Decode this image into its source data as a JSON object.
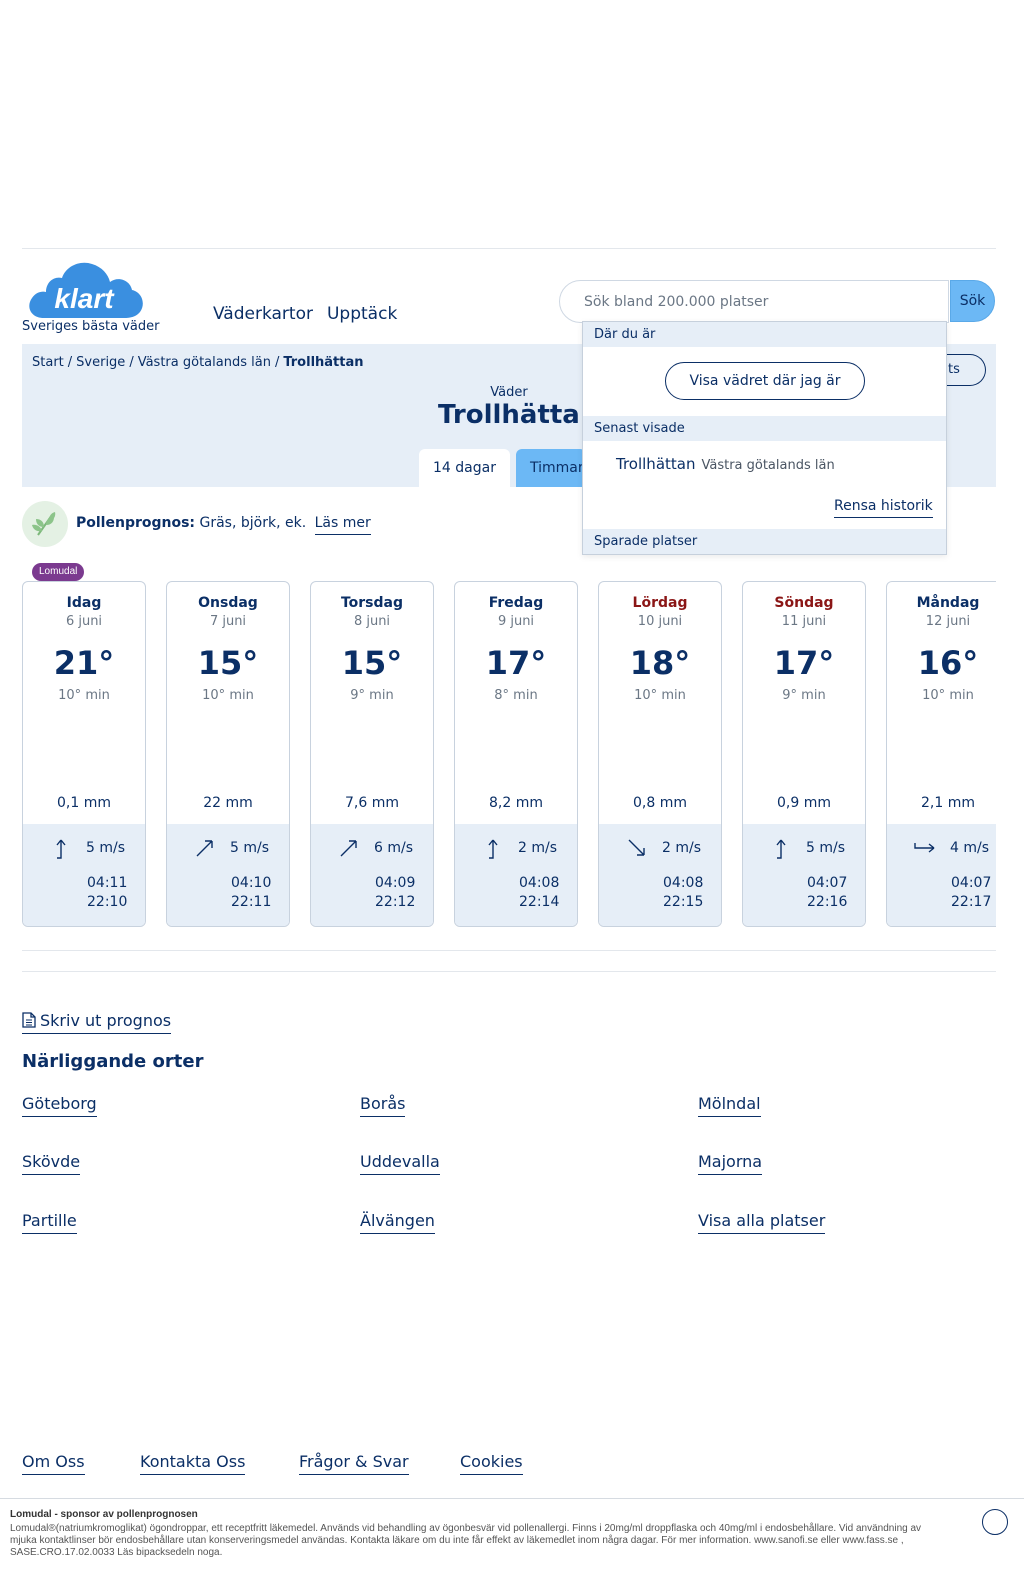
{
  "header": {
    "logo_text": "klart",
    "tagline": "Sveriges bästa väder",
    "nav": [
      "Väderkartor",
      "Upptäck"
    ],
    "search_placeholder": "Sök bland 200.000 platser",
    "search_button": "Sök"
  },
  "breadcrumb": [
    "Start",
    "Sverige",
    "Västra götalands län",
    "Trollhättan"
  ],
  "hero": {
    "subtitle": "Väder",
    "title": "Trollhättan",
    "save_label": "ats",
    "tabs": [
      "14 dagar",
      "Timmar"
    ]
  },
  "dropdown": {
    "here_header": "Där du är",
    "locate_button": "Visa vädret där jag är",
    "recent_header": "Senast visade",
    "recent": [
      {
        "name": "Trollhättan",
        "region": "Västra götalands län"
      }
    ],
    "clear_history": "Rensa historik",
    "saved_header": "Sparade platser"
  },
  "pollen": {
    "label": "Pollenprognos:",
    "text": "Gräs, björk, ek.",
    "more": "Läs mer",
    "sponsor_badge": "Lomudal"
  },
  "days": [
    {
      "day": "Idag",
      "date": "6 juni",
      "temp": "21°",
      "min": "10° min",
      "precip": "0,1 mm",
      "wind": "5 m/s",
      "sunrise": "04:11",
      "sunset": "22:10",
      "weekend": false,
      "wind_dir": "north"
    },
    {
      "day": "Onsdag",
      "date": "7 juni",
      "temp": "15°",
      "min": "10° min",
      "precip": "22 mm",
      "wind": "5 m/s",
      "sunrise": "04:10",
      "sunset": "22:11",
      "weekend": false,
      "wind_dir": "northeast"
    },
    {
      "day": "Torsdag",
      "date": "8 juni",
      "temp": "15°",
      "min": "9° min",
      "precip": "7,6 mm",
      "wind": "6 m/s",
      "sunrise": "04:09",
      "sunset": "22:12",
      "weekend": false,
      "wind_dir": "northeast"
    },
    {
      "day": "Fredag",
      "date": "9 juni",
      "temp": "17°",
      "min": "8° min",
      "precip": "8,2 mm",
      "wind": "2 m/s",
      "sunrise": "04:08",
      "sunset": "22:14",
      "weekend": false,
      "wind_dir": "north"
    },
    {
      "day": "Lördag",
      "date": "10 juni",
      "temp": "18°",
      "min": "10° min",
      "precip": "0,8 mm",
      "wind": "2 m/s",
      "sunrise": "04:08",
      "sunset": "22:15",
      "weekend": true,
      "wind_dir": "southeast"
    },
    {
      "day": "Söndag",
      "date": "11 juni",
      "temp": "17°",
      "min": "9° min",
      "precip": "0,9 mm",
      "wind": "5 m/s",
      "sunrise": "04:07",
      "sunset": "22:16",
      "weekend": true,
      "wind_dir": "north"
    },
    {
      "day": "Måndag",
      "date": "12 juni",
      "temp": "16°",
      "min": "10° min",
      "precip": "2,1 mm",
      "wind": "4 m/s",
      "sunrise": "04:07",
      "sunset": "22:17",
      "weekend": false,
      "wind_dir": "east"
    }
  ],
  "print_link": "Skriv ut prognos",
  "nearby": {
    "title": "Närliggande orter",
    "places": [
      "Göteborg",
      "Borås",
      "Mölndal",
      "Skövde",
      "Uddevalla",
      "Majorna",
      "Partille",
      "Älvängen",
      "Visa alla platser"
    ]
  },
  "footer": {
    "links": [
      "Om Oss",
      "Kontakta Oss",
      "Frågor & Svar",
      "Cookies"
    ]
  },
  "sponsor": {
    "title": "Lomudal - sponsor av pollenprognosen",
    "body": "Lomudal®(natriumkromoglikat) ögondroppar, ett receptfritt läkemedel. Används vid behandling av ögonbesvär vid pollenallergi. Finns i 20mg/ml droppflaska och 40mg/ml i endosbehållare. Vid användning av mjuka kontaktlinser bör endosbehållare utan konserveringsmedel användas. Kontakta läkare om du inte får effekt av läkemedlet inom några dagar. För mer information. www.sanofi.se eller www.fass.se , SASE.CRO.17.02.0033 Läs bipacksedeln noga."
  },
  "colors": {
    "brand_blue": "#0b2f66",
    "accent_blue": "#6cb8f5",
    "panel_bg": "#e6eef7",
    "weekend_red": "#8b1616",
    "sponsor_purple": "#7b3a8f"
  }
}
